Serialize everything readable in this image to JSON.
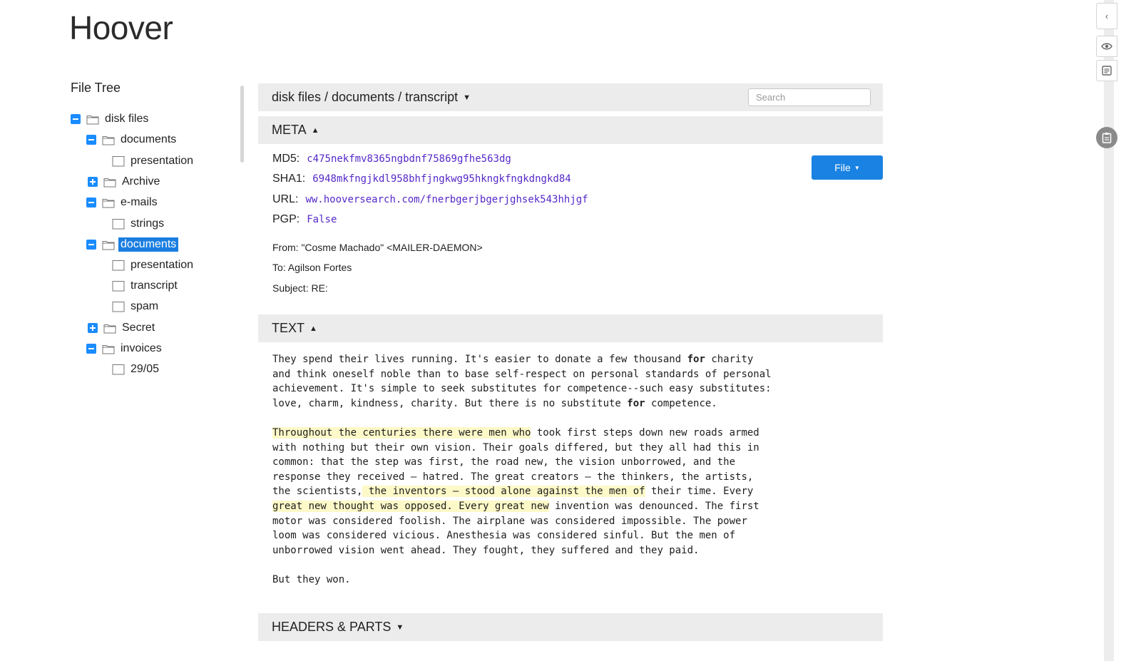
{
  "app": {
    "title": "Hoover"
  },
  "file_tree": {
    "heading": "File Tree",
    "items": [
      {
        "label": "disk files",
        "toggle": "minus",
        "icon": "folder-icon"
      },
      {
        "label": "documents",
        "toggle": "minus",
        "icon": "folder-icon"
      },
      {
        "label": "presentation",
        "toggle": "none",
        "icon": "file-icon"
      },
      {
        "label": "Archive",
        "toggle": "plus",
        "icon": "folder-icon"
      },
      {
        "label": "e-mails",
        "toggle": "minus",
        "icon": "folder-icon"
      },
      {
        "label": "strings",
        "toggle": "none",
        "icon": "file-icon"
      },
      {
        "label": "documents",
        "toggle": "minus",
        "icon": "folder-icon",
        "selected": true
      },
      {
        "label": "presentation",
        "toggle": "none",
        "icon": "file-icon"
      },
      {
        "label": "transcript",
        "toggle": "none",
        "icon": "file-icon"
      },
      {
        "label": "spam",
        "toggle": "none",
        "icon": "file-icon"
      },
      {
        "label": "Secret",
        "toggle": "plus",
        "icon": "folder-icon"
      },
      {
        "label": "invoices",
        "toggle": "minus",
        "icon": "folder-icon"
      },
      {
        "label": "29/05",
        "toggle": "none",
        "icon": "file-icon"
      }
    ]
  },
  "breadcrumb": {
    "path": "disk files / documents / transcript",
    "caret": "▼",
    "search_placeholder": "Search"
  },
  "meta": {
    "label": "META",
    "caret": "▲",
    "md5_key": "MD5:",
    "md5": "c475nekfmv8365ngbdnf75869gfhe563dg",
    "sha1_key": "SHA1:",
    "sha1": "6948mkfngjkdl958bhfjngkwg95hkngkfngkdngkd84",
    "url_key": "URL:",
    "url": "ww.hooversearch.com/fnerbgerjbgerjghsek543hhjgf",
    "pgp_key": "PGP:",
    "pgp": "False",
    "file_button": "File",
    "file_caret": "▼",
    "from": "From: \"Cosme Machado\" <MAILER-DAEMON>",
    "to": "To: Agilson Fortes",
    "subject": "Subject: RE:"
  },
  "text_section": {
    "label": "TEXT",
    "caret": "▲",
    "p1_l1_a": "They spend their lives running. It's easier to donate a few thousand ",
    "p1_l1_b": "for",
    "p1_l1_c": " charity",
    "p1_l2": "and think oneself noble than to base self-respect on personal standards of personal",
    "p1_l3": "achievement. It's simple to seek substitutes for competence--such easy substitutes:",
    "p1_l4_a": "love, charm, kindness, charity. But there is no substitute ",
    "p1_l4_b": "for",
    "p1_l4_c": " competence.",
    "p2_l1_hl": "Throughout the centuries there were men who",
    "p2_l1_rest": " took first steps down new roads armed",
    "p2_l2": "with nothing but their own vision. Their goals differed, but they all had this in",
    "p2_l3": "common: that the step was first, the road new, the vision unborrowed, and the",
    "p2_l4": "response they received — hatred. The great creators — the thinkers, the artists,",
    "p2_l5_a": "the scientists,",
    "p2_l5_hl": " the inventors — stood alone against the men of",
    "p2_l5_c": " their time. Every",
    "p2_l6_hl": "great new thought was opposed. Every great new",
    "p2_l6_rest": " invention was denounced. The first",
    "p2_l7": "motor was considered foolish. The airplane was considered impossible. The power",
    "p2_l8": "loom was considered vicious. Anesthesia was considered sinful. But the men of",
    "p2_l9": "unborrowed vision went ahead. They fought, they suffered and they paid.",
    "p3": "But they won."
  },
  "headers_parts": {
    "label": "HEADERS & PARTS",
    "caret": "▼"
  },
  "sidebar_controls": {
    "collapse": "‹",
    "preview": "eye-icon",
    "notes": "notes-icon",
    "clipboard": "clipboard-icon"
  },
  "colors": {
    "accent": "#1a82e2",
    "selected": "#1a7ee0",
    "hash": "#5528c8",
    "highlight": "#fdf9c8",
    "bar": "#ececec"
  }
}
